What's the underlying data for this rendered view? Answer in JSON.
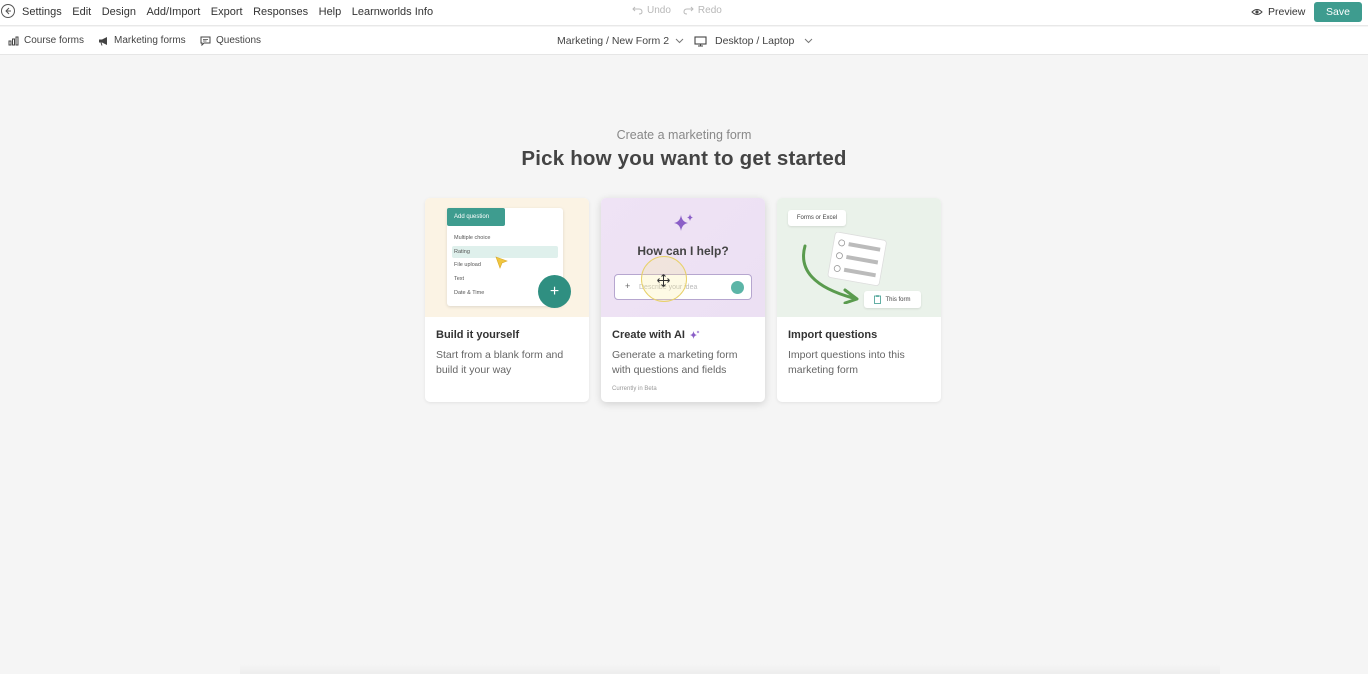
{
  "menubar": {
    "items": [
      "Settings",
      "Edit",
      "Design",
      "Add/Import",
      "Export",
      "Responses",
      "Help",
      "Learnworlds Info"
    ],
    "undo": "Undo",
    "redo": "Redo",
    "preview": "Preview",
    "save": "Save"
  },
  "subbar": {
    "course_forms": "Course forms",
    "marketing_forms": "Marketing forms",
    "questions": "Questions",
    "breadcrumb": "Marketing / New Form 2",
    "device": "Desktop / Laptop"
  },
  "main": {
    "subtitle": "Create a marketing form",
    "title": "Pick how you want to get started"
  },
  "cards": [
    {
      "title": "Build it yourself",
      "description": "Start from a blank form and build it your way",
      "illustration": {
        "header": "Add question",
        "options": [
          "Multiple choice",
          "Rating",
          "File upload",
          "Text",
          "Date & Time"
        ]
      }
    },
    {
      "title": "Create with AI",
      "description": "Generate a marketing form with questions and fields",
      "note": "Currently in Beta",
      "illustration": {
        "question": "How can I help?",
        "placeholder": "Describe your idea"
      }
    },
    {
      "title": "Import questions",
      "description": "Import questions into this marketing form",
      "illustration": {
        "source_tag": "Forms or Excel",
        "target_tag": "This form"
      }
    }
  ],
  "colors": {
    "accent": "#3e9c8f",
    "background": "#f5f5f5"
  }
}
